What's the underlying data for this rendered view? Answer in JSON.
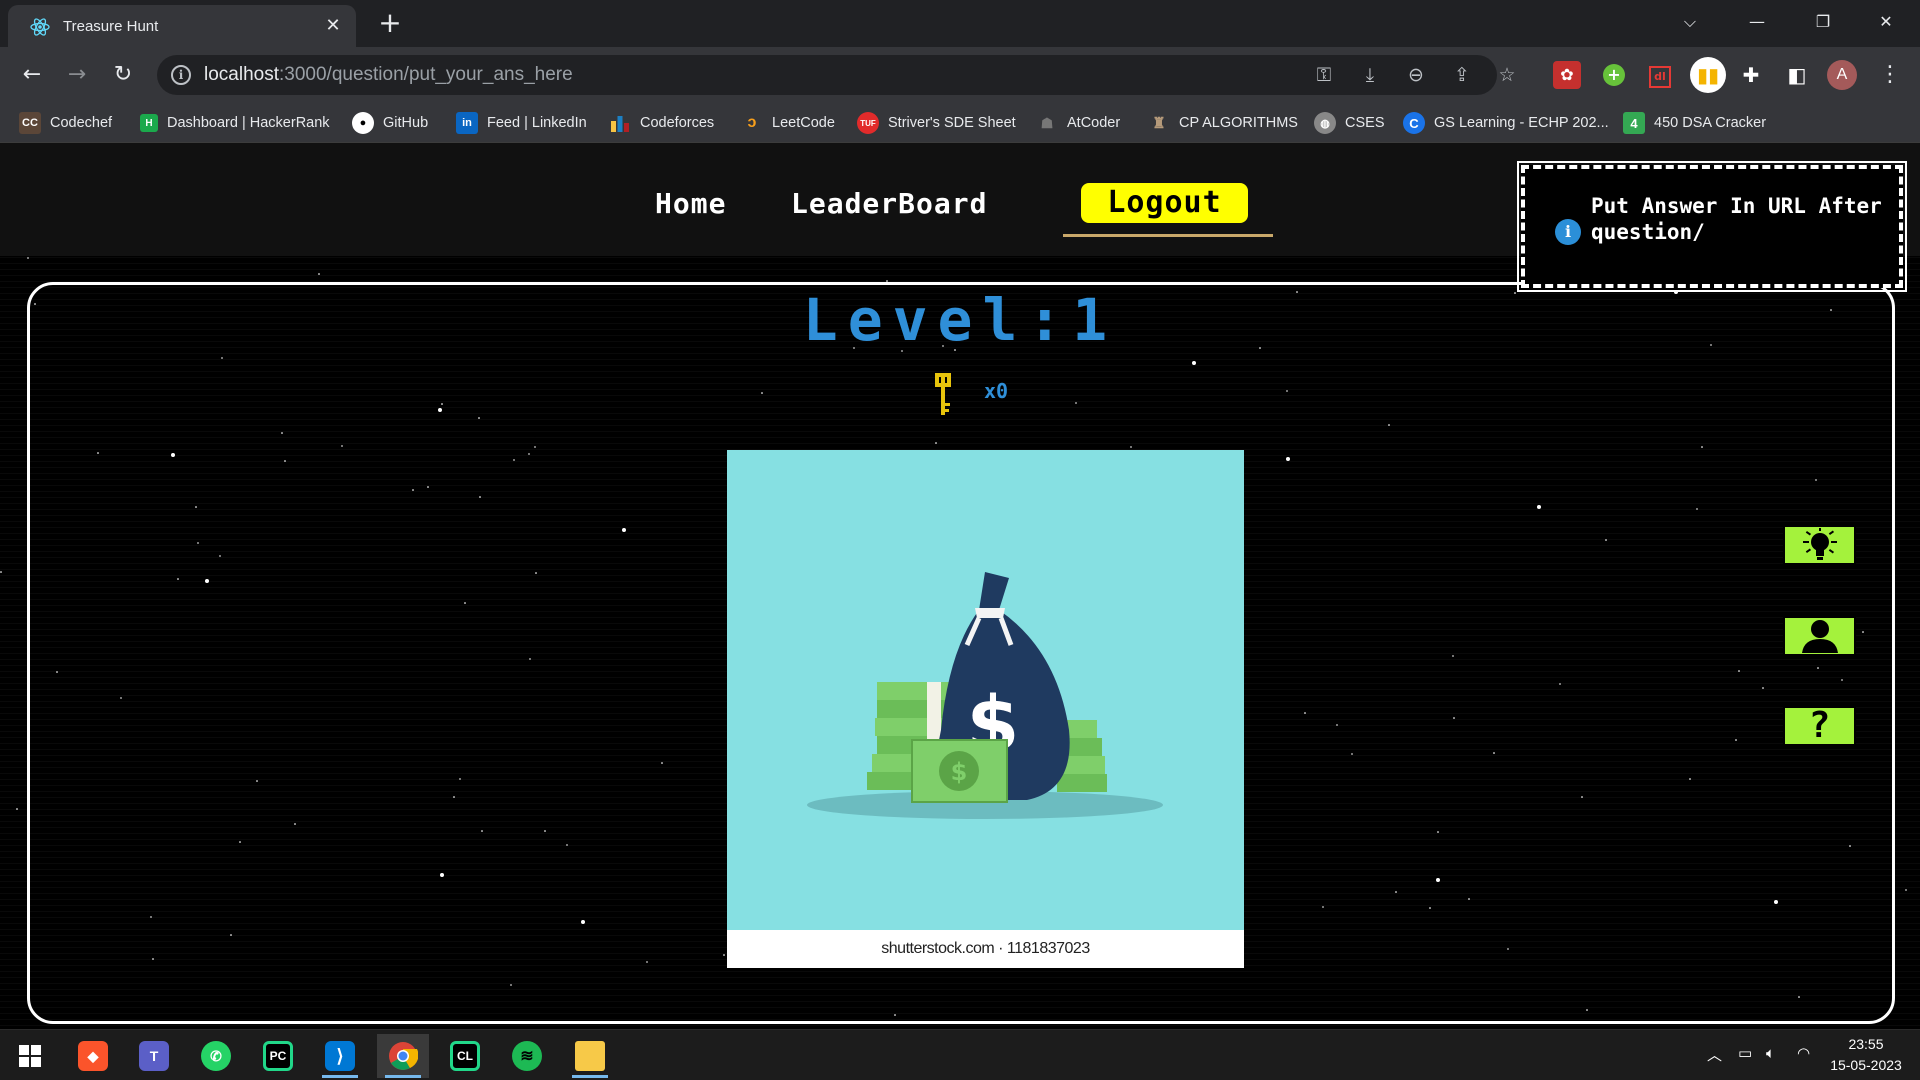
{
  "browser": {
    "tab": {
      "title": "Treasure Hunt",
      "favicon": "react-icon"
    },
    "new_tab_label": "+",
    "window_controls": {
      "dropdown": "⌵",
      "minimize": "—",
      "restore": "❐",
      "close": "✕"
    },
    "url": {
      "host": "localhost",
      "path": ":3000/question/put_your_ans_here"
    },
    "profile_initial": "A",
    "bookmarks": [
      {
        "label": "Codechef",
        "icon": "codechef-icon"
      },
      {
        "label": "Dashboard | HackerRank",
        "icon": "hackerrank-icon"
      },
      {
        "label": "GitHub",
        "icon": "github-icon"
      },
      {
        "label": "Feed | LinkedIn",
        "icon": "linkedin-icon"
      },
      {
        "label": "Codeforces",
        "icon": "codeforces-icon"
      },
      {
        "label": "LeetCode",
        "icon": "leetcode-icon"
      },
      {
        "label": "Striver's SDE Sheet",
        "icon": "tuf-icon"
      },
      {
        "label": "AtCoder",
        "icon": "atcoder-icon"
      },
      {
        "label": "CP ALGORITHMS",
        "icon": "cp-algorithms-icon"
      },
      {
        "label": "CSES",
        "icon": "cses-icon"
      },
      {
        "label": "GS Learning - ECHP 202...",
        "icon": "gs-learning-icon"
      },
      {
        "label": "450 DSA Cracker",
        "icon": "dsa-cracker-icon"
      }
    ]
  },
  "page": {
    "nav": {
      "home": "Home",
      "leaderboard": "LeaderBoard",
      "logout": "Logout"
    },
    "info_message": "Put Answer In URL After question/",
    "level_title": "Level:1",
    "keys_count": "x0",
    "image_caption": "shutterstock.com · 1181837023",
    "side_buttons": [
      "hint-lightbulb-icon",
      "profile-user-icon",
      "help-question-icon"
    ],
    "colors": {
      "accent_blue": "#2f8fd8",
      "logout_yellow": "#ffff00",
      "side_button_green": "#a4f23c",
      "image_bg": "#86e0e2"
    }
  },
  "taskbar": {
    "apps": [
      "windows-start-icon",
      "brave-icon",
      "teams-icon",
      "whatsapp-icon",
      "pycharm-icon",
      "vscode-icon",
      "chrome-icon",
      "clion-icon",
      "spotify-icon",
      "file-explorer-icon"
    ],
    "time": "23:55",
    "date": "15-05-2023"
  }
}
